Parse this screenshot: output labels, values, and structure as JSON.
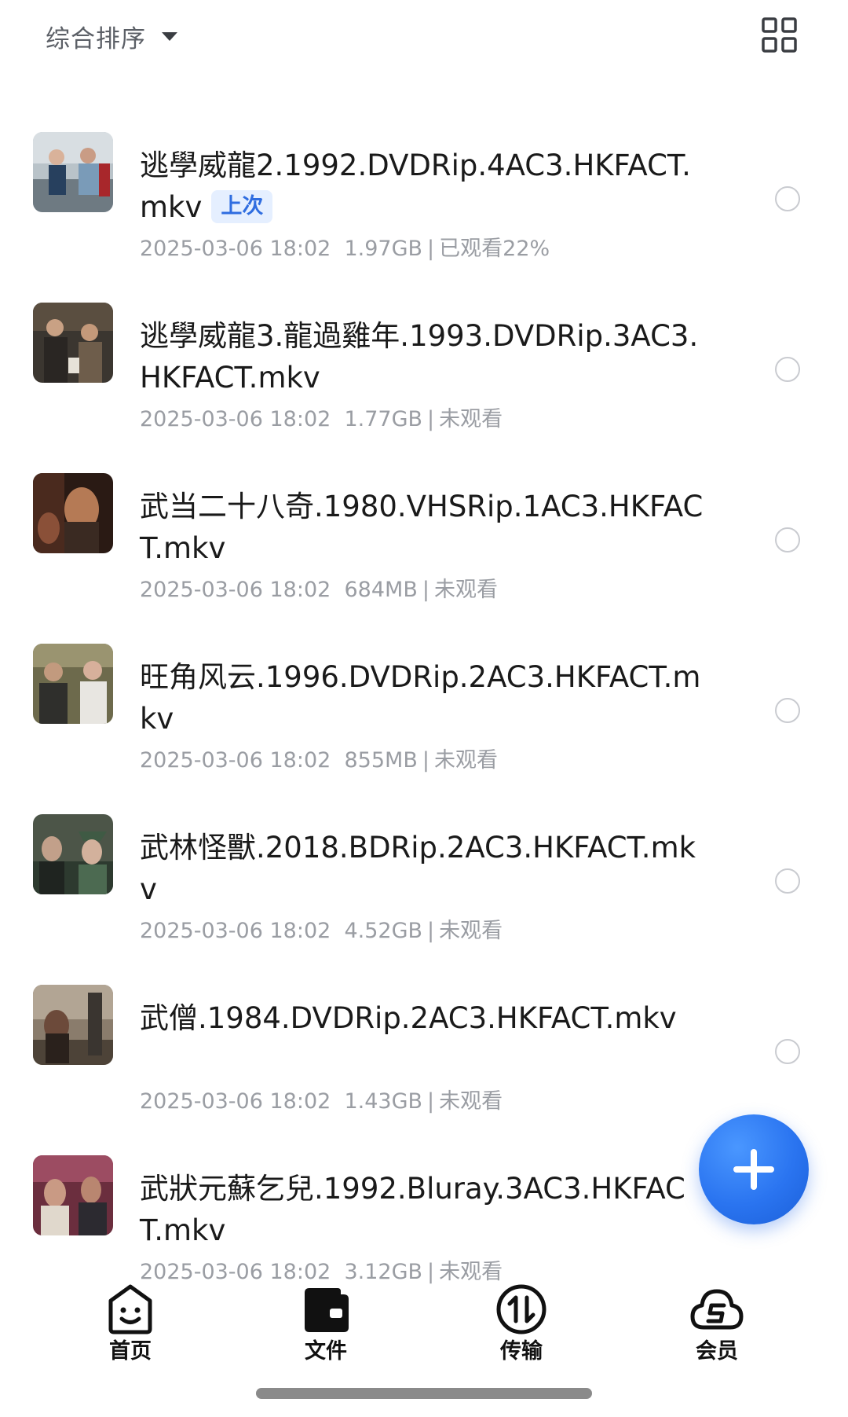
{
  "header": {
    "sort_label": "综合排序"
  },
  "files": [
    {
      "name": "逃學威龍2.1992.DVDRip.4AC3.HKFACT.mkv",
      "badge": "上次",
      "date": "2025-03-06 18:02",
      "size": "1.97GB",
      "status": "已观看22%"
    },
    {
      "name": "逃學威龍3.龍過雞年.1993.DVDRip.3AC3.HKFACT.mkv",
      "date": "2025-03-06 18:02",
      "size": "1.77GB",
      "status": "未观看"
    },
    {
      "name": "武当二十八奇.1980.VHSRip.1AC3.HKFACT.mkv",
      "date": "2025-03-06 18:02",
      "size": "684MB",
      "status": "未观看"
    },
    {
      "name": "旺角风云.1996.DVDRip.2AC3.HKFACT.mkv",
      "date": "2025-03-06 18:02",
      "size": "855MB",
      "status": "未观看"
    },
    {
      "name": "武林怪獸.2018.BDRip.2AC3.HKFACT.mkv",
      "date": "2025-03-06 18:02",
      "size": "4.52GB",
      "status": "未观看"
    },
    {
      "name": "武僧.1984.DVDRip.2AC3.HKFACT.mkv",
      "date": "2025-03-06 18:02",
      "size": "1.43GB",
      "status": "未观看"
    },
    {
      "name": "武狀元蘇乞兒.1992.Bluray.3AC3.HKFACT.mkv",
      "date": "2025-03-06 18:02",
      "size": "3.12GB",
      "status": "未观看"
    }
  ],
  "meta_separator": "|",
  "nav": {
    "home": "首页",
    "files": "文件",
    "transfer": "传输",
    "vip": "会员"
  },
  "icons": {
    "sort": "caret-down-icon",
    "view": "grid-view-icon",
    "add": "plus-icon",
    "home": "smiley-home-icon",
    "files": "wallet-folder-icon",
    "transfer": "transfer-icon",
    "vip": "cloud-s-icon"
  },
  "colors": {
    "accent": "#2f6de0",
    "badge_bg": "#e5efff",
    "meta_text": "#9a9da3"
  }
}
